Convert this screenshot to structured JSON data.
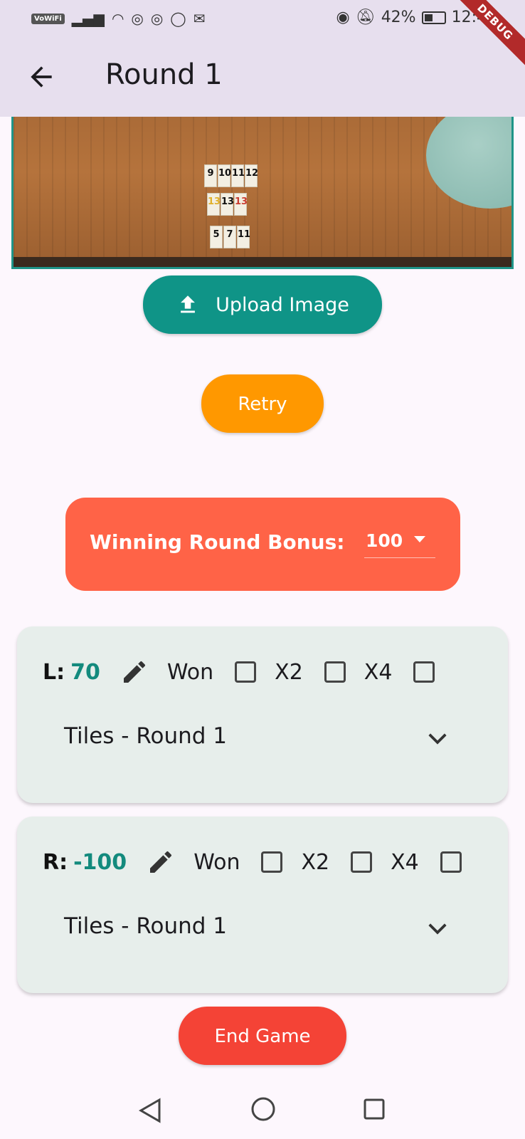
{
  "status_bar": {
    "network_label": "VoWiFi",
    "battery": "42%",
    "time": "12:42",
    "debug_label": "DEBUG"
  },
  "app_bar": {
    "title": "Round 1"
  },
  "photo": {
    "tiles_rows": [
      [
        "9",
        "10",
        "11",
        "12"
      ],
      [
        "13",
        "13",
        "13"
      ],
      [
        "5",
        "7",
        "11"
      ]
    ]
  },
  "actions": {
    "upload_label": "Upload Image",
    "retry_label": "Retry",
    "end_label": "End Game"
  },
  "bonus": {
    "label": "Winning Round Bonus:",
    "value": "100"
  },
  "players": [
    {
      "tag": "L:",
      "score": "70",
      "won_label": "Won",
      "x2_label": "X2",
      "x4_label": "X4",
      "tiles_label": "Tiles - Round 1"
    },
    {
      "tag": "R:",
      "score": "-100",
      "won_label": "Won",
      "x2_label": "X2",
      "x4_label": "X4",
      "tiles_label": "Tiles - Round 1"
    }
  ],
  "colors": {
    "app_bar": "#e7dfee",
    "upload": "#0f9487",
    "retry": "#ff9800",
    "bonus": "#ff6347",
    "end": "#f44336",
    "score": "#138a7d"
  }
}
